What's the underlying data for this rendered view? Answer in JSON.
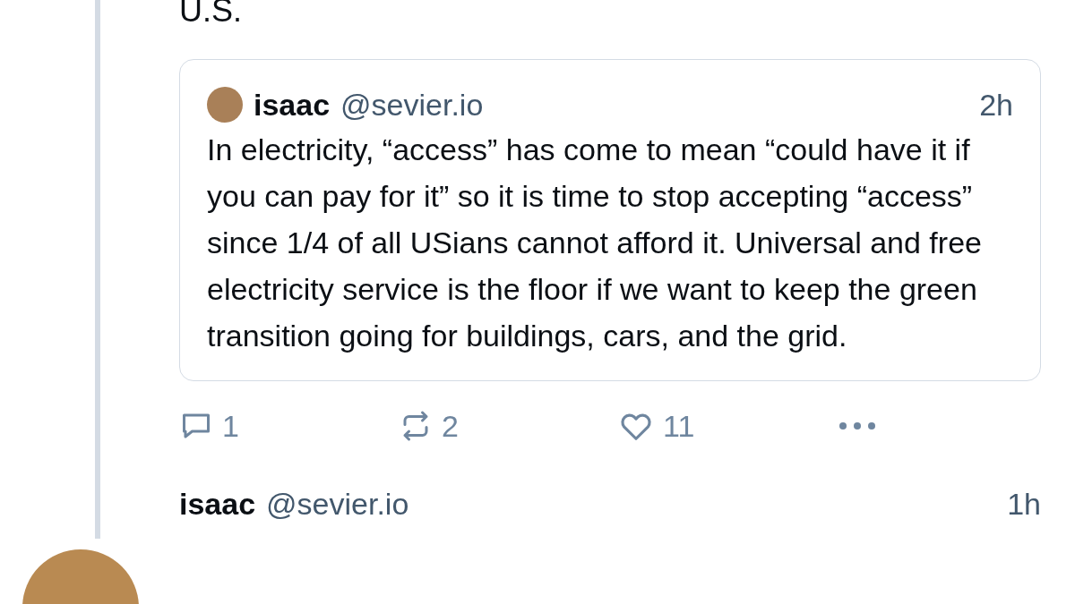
{
  "post": {
    "text": "U.S.",
    "quote": {
      "name": "isaac",
      "handle": "@sevier.io",
      "time": "2h",
      "text": "In electricity, “access” has come to mean “could have it if you can pay for it” so it is time to stop accepting “access” since 1/4 of all USians cannot afford it. Universal and free electricity service is the floor if we want to keep the green transition going for buildings, cars, and the grid."
    },
    "actions": [
      {
        "kind": "reply",
        "count": "1"
      },
      {
        "kind": "repost",
        "count": "2"
      },
      {
        "kind": "like",
        "count": "11"
      },
      {
        "kind": "more"
      }
    ]
  },
  "next_post": {
    "name": "isaac",
    "handle": "@sevier.io",
    "time": "1h"
  }
}
